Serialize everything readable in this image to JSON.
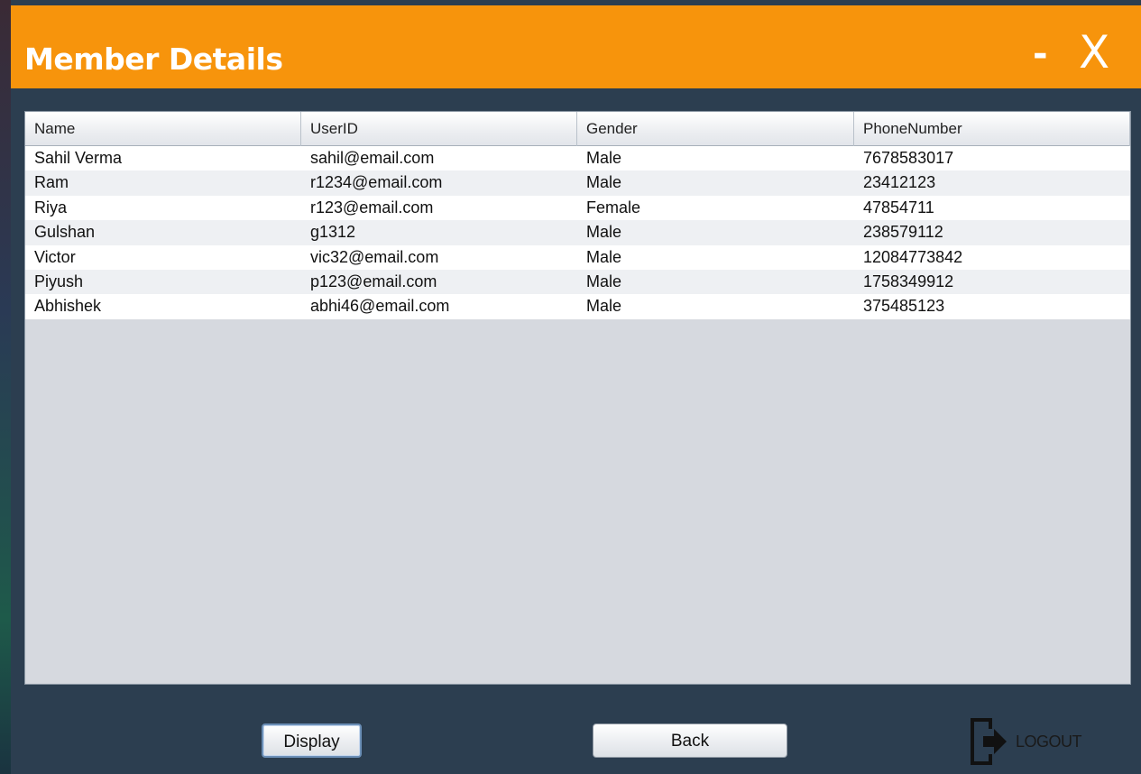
{
  "window": {
    "title": "Member Details",
    "minimize_label": "-",
    "close_label": "X",
    "accent_color": "#f7940c"
  },
  "table": {
    "columns": [
      "Name",
      "UserID",
      "Gender",
      "PhoneNumber"
    ],
    "rows": [
      [
        "Sahil Verma",
        "sahil@email.com",
        "Male",
        "7678583017"
      ],
      [
        "Ram",
        "r1234@email.com",
        "Male",
        "23412123"
      ],
      [
        "Riya",
        "r123@email.com",
        "Female",
        "47854711"
      ],
      [
        "Gulshan",
        "g1312",
        "Male",
        "238579112"
      ],
      [
        "Victor",
        "vic32@email.com",
        "Male",
        "12084773842"
      ],
      [
        "Piyush",
        "p123@email.com",
        "Male",
        "1758349912"
      ],
      [
        "Abhishek",
        "abhi46@email.com",
        "Male",
        "375485123"
      ]
    ]
  },
  "buttons": {
    "display_label": "Display",
    "back_label": "Back",
    "logout_label": "LOGOUT",
    "logout_icon": "logout-icon"
  }
}
